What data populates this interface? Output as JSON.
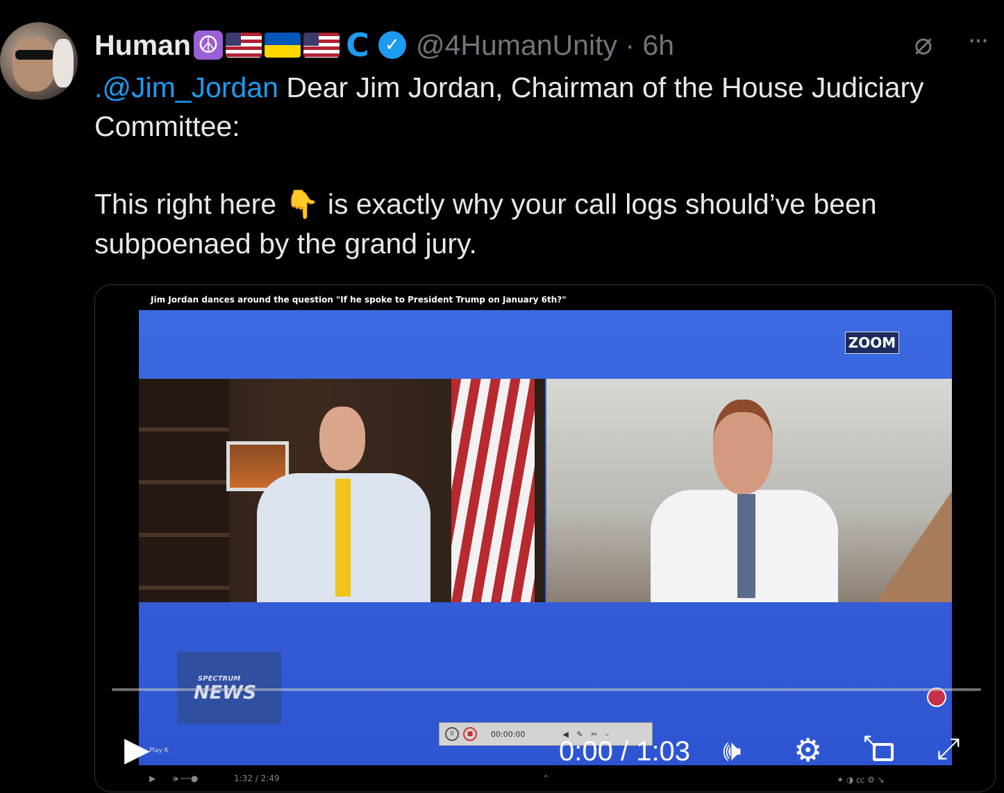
{
  "author": {
    "name": "Human",
    "emoji_badges": [
      "peace-symbol-emoji",
      "us-flag-emoji",
      "ukraine-flag-emoji",
      "us-flag-emoji",
      "c-wave-badge"
    ],
    "handle": "@4HumanUnity",
    "time": " · 6h"
  },
  "tweet": {
    "mention": ".@Jim_Jordan",
    "line1": " Dear Jim Jordan, Chairman of the House Judiciary Committee:",
    "line2_a": "This right here",
    "emoji": "👇",
    "line2_b": "is exactly why your call logs should’ve been subpoenaed by the grand jury."
  },
  "video": {
    "inner_title": "Jim Jordan dances around the question \"If he spoke to President Trump on January 6th?\"",
    "zoom_label": "ZOOM",
    "spectrum_small": "SPECTRUM",
    "spectrum_big": "NEWS",
    "recorder_time": "00:00:00",
    "play_hint": "Play  K",
    "embedded_time": "1:32 / 2:49",
    "current_time": "0:00",
    "duration": "1:03",
    "timer_text": "0:00 / 1:03",
    "progress_fraction": 0
  },
  "colors": {
    "accent": "#1d9bf0",
    "muted": "#71767b",
    "background": "#000000",
    "text": "#e7e9ea"
  }
}
